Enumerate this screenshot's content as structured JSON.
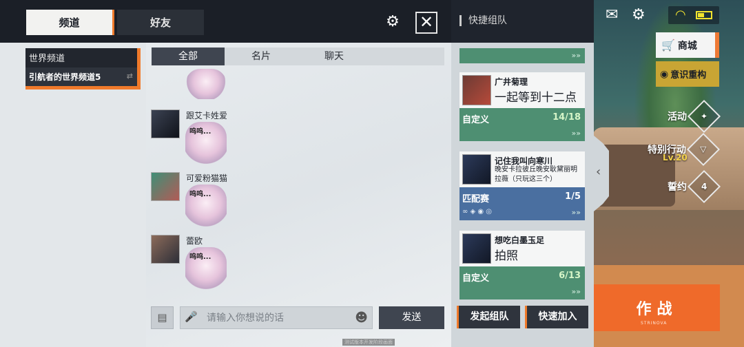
{
  "header": {
    "tab_channel": "频道",
    "tab_friends": "好友",
    "quick_team_title": "快捷组队"
  },
  "icons": {
    "settings": "gear-icon",
    "close": "close-icon",
    "mail": "mail-icon",
    "wifi": "wifi-icon",
    "battery": "battery-icon"
  },
  "sidebar_right": {
    "shop_label": "商城",
    "reconstruct_label": "意识重构",
    "activity_label": "活动",
    "special_label": "特别行动",
    "special_level": "Lv.20",
    "oath_label": "誓约",
    "oath_count": "4",
    "battle_label": "作战",
    "battle_sub": "STRINOVA"
  },
  "channels": {
    "world_title": "世界频道",
    "selected_channel": "引航者的世界频道5"
  },
  "chat": {
    "tabs": [
      {
        "label": "全部"
      },
      {
        "label": "名片"
      },
      {
        "label": "聊天"
      }
    ],
    "messages": [
      {
        "sender": "跟艾卡姓爱",
        "text": "呜呜..."
      },
      {
        "sender": "可爱粉猫猫",
        "text": "呜呜..."
      },
      {
        "sender": "蕾欧",
        "text": "呜呜..."
      }
    ],
    "input_placeholder": "请输入你想说的话",
    "send_label": "发送",
    "bottom_hint": "测试版本开发阶段画面"
  },
  "teams": [
    {
      "name": "广井菊理",
      "desc": "一起等到十二点",
      "type": "自定义",
      "count": "14/18",
      "color": "#4e8f72"
    },
    {
      "name": "记住我叫向寒川",
      "desc": "晚安卡拉彼丘晚安耿黛丽明拉薇（只玩这三个）",
      "type": "匹配赛",
      "count": "1/5",
      "color": "#4a6fa0"
    },
    {
      "name": "想吃白墨玉足",
      "desc": "拍照",
      "type": "自定义",
      "count": "6/13",
      "color": "#4e8f72"
    }
  ],
  "team_actions": {
    "start_team": "发起组队",
    "quick_join": "快速加入"
  }
}
